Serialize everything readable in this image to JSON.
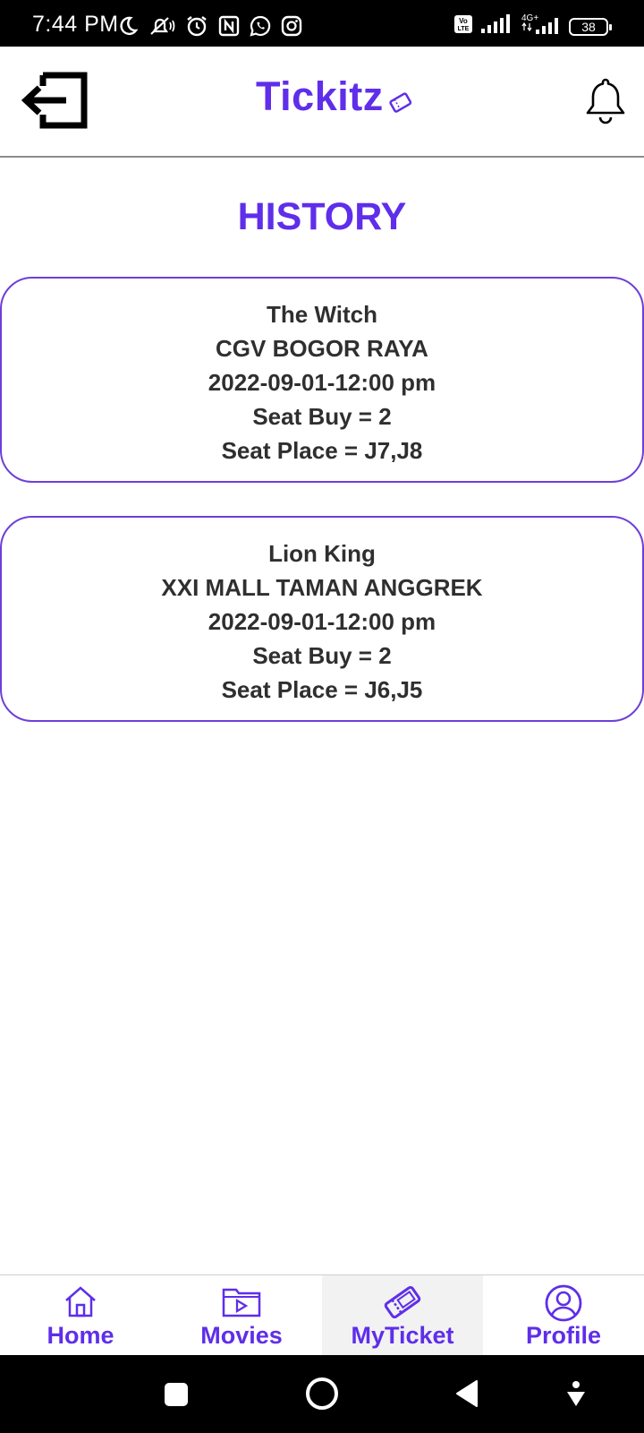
{
  "status_bar": {
    "time": "7:44 PM",
    "battery": "38",
    "network": "4G+",
    "volte": "Vo LTE"
  },
  "header": {
    "logo": "Tickitz"
  },
  "page": {
    "title": "HISTORY"
  },
  "history": [
    {
      "movie": "The Witch",
      "cinema": "CGV BOGOR RAYA",
      "datetime": "2022-09-01-12:00 pm",
      "seat_buy": "Seat Buy = 2",
      "seat_place": "Seat Place = J7,J8"
    },
    {
      "movie": "Lion King",
      "cinema": "XXI MALL TAMAN ANGGREK",
      "datetime": "2022-09-01-12:00 pm",
      "seat_buy": "Seat Buy = 2",
      "seat_place": "Seat Place = J6,J5"
    }
  ],
  "bottom_nav": [
    {
      "label": "Home",
      "icon": "home-icon"
    },
    {
      "label": "Movies",
      "icon": "movies-icon"
    },
    {
      "label": "MyTicket",
      "icon": "ticket-icon",
      "active": true
    },
    {
      "label": "Profile",
      "icon": "profile-icon"
    }
  ],
  "colors": {
    "brand": "#5f2eea",
    "card_border": "#6d3fd8",
    "text": "#2f2f2f"
  }
}
